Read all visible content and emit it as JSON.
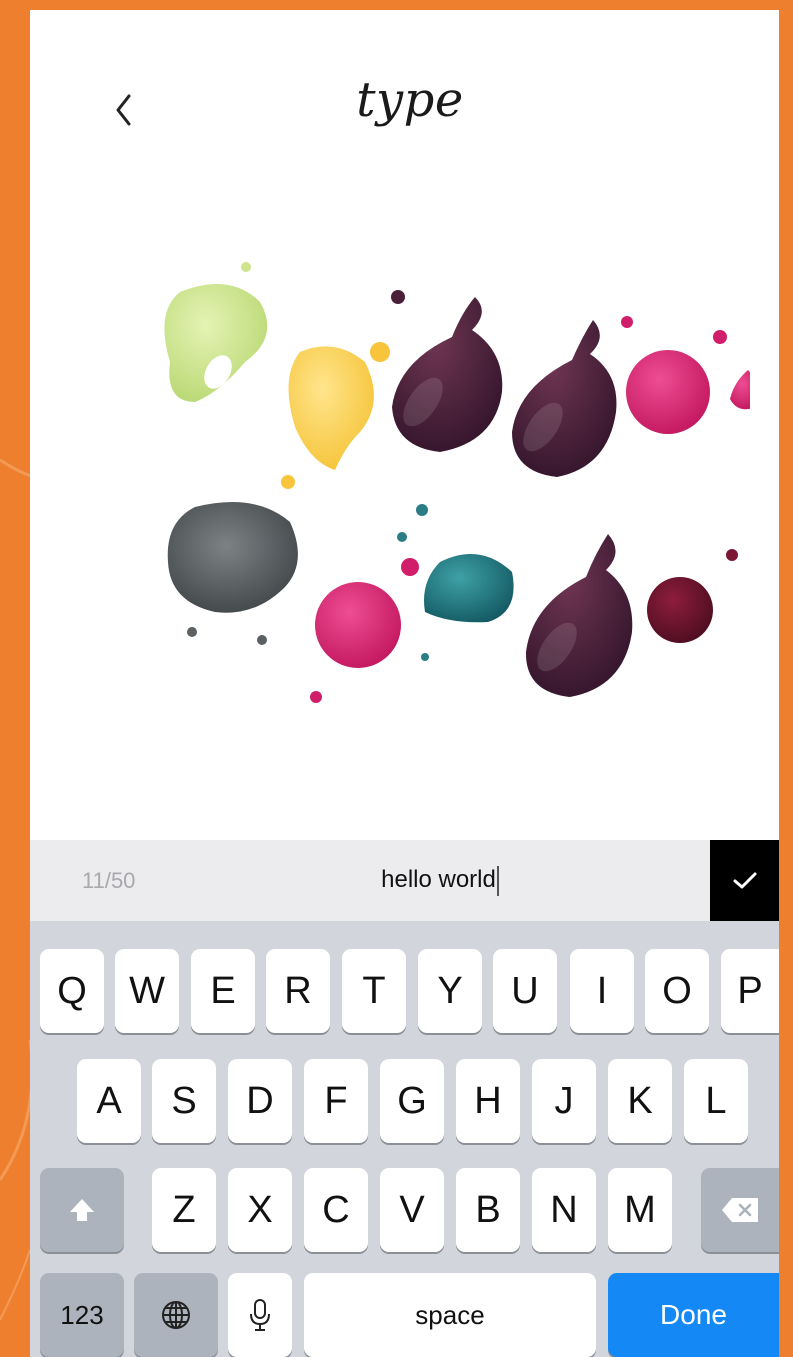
{
  "header": {
    "title": "type",
    "back_icon": "chevron-left-icon"
  },
  "input": {
    "counter": "11/50",
    "value": "hello world",
    "confirm_icon": "checkmark-icon"
  },
  "keyboard": {
    "row1": [
      "Q",
      "W",
      "E",
      "R",
      "T",
      "Y",
      "U",
      "I",
      "O",
      "P"
    ],
    "row2": [
      "A",
      "S",
      "D",
      "F",
      "G",
      "H",
      "J",
      "K",
      "L"
    ],
    "row3": [
      "Z",
      "X",
      "C",
      "V",
      "B",
      "N",
      "M"
    ],
    "shift_icon": "shift-arrow-icon",
    "delete_icon": "backspace-icon",
    "numbers_label": "123",
    "globe_icon": "globe-icon",
    "mic_icon": "microphone-icon",
    "space_label": "space",
    "done_label": "Done"
  },
  "colors": {
    "background": "#ee7f2f",
    "done_key": "#1488f5",
    "confirm_button": "#000000",
    "keyboard_bg": "#d2d5db"
  }
}
